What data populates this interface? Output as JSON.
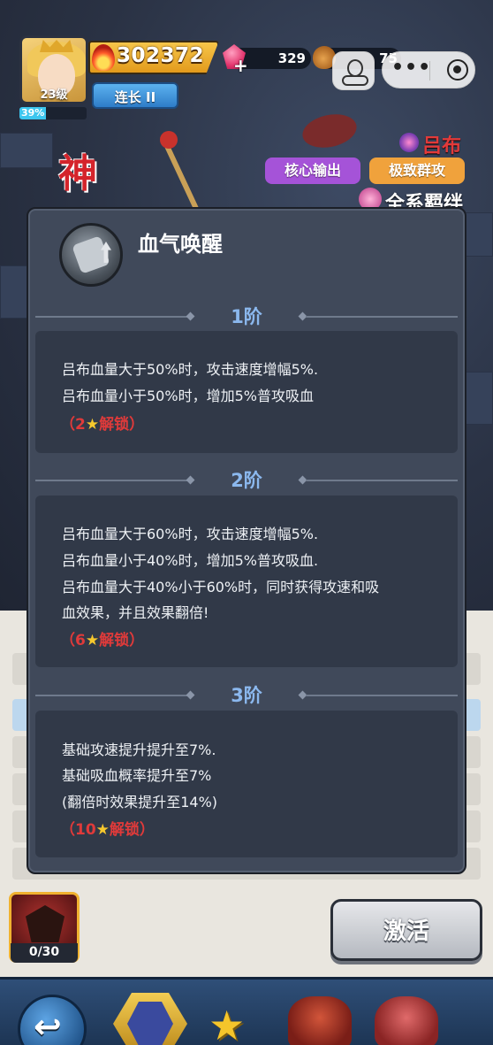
{
  "player": {
    "level": "23级",
    "exp_percent": "39%",
    "exp_fraction": 0.39,
    "power": "302372",
    "rank": "连长 II"
  },
  "resources": {
    "gems": "329",
    "nuts": "75"
  },
  "hero": {
    "title_char": "神",
    "name": "吕布",
    "tags": [
      "核心输出",
      "极致群攻"
    ],
    "bond": "全系羁绊"
  },
  "skill_modal": {
    "name": "血气唤醒",
    "tiers": [
      {
        "label": "1阶",
        "lines": [
          "吕布血量大于50%时，攻击速度增幅5%.",
          "吕布血量小于50%时，增加5%普攻吸血"
        ],
        "unlock_prefix": "（2",
        "unlock_suffix": "解锁）"
      },
      {
        "label": "2阶",
        "lines": [
          "吕布血量大于60%时，攻击速度增幅5%.",
          "吕布血量小于40%时，增加5%普攻吸血.",
          "吕布血量大于40%小于60%时，同时获得攻速和吸",
          "血效果，并且效果翻倍!"
        ],
        "unlock_prefix": "（6",
        "unlock_suffix": "解锁）"
      },
      {
        "label": "3阶",
        "lines": [
          "基础攻速提升提升至7%.",
          "基础吸血概率提升至7%",
          "(翻倍时效果提升至14%)"
        ],
        "unlock_prefix": "（10",
        "unlock_suffix": "解锁）"
      }
    ]
  },
  "bottom": {
    "shards": "0/30",
    "activate_label": "激活"
  },
  "icons": {
    "back": "back-arrow-icon",
    "star": "★",
    "more": "•••"
  },
  "colors": {
    "unlock_red": "#e03a3a",
    "tier_blue": "#8bb8ee",
    "tag_purple": "#a553d8",
    "tag_orange": "#f0a23c"
  }
}
